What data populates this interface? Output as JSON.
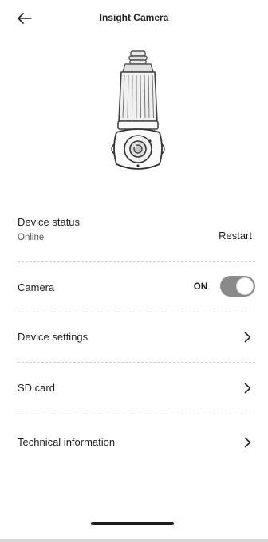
{
  "header": {
    "title": "Insight Camera",
    "back_icon": "arrow-left-icon"
  },
  "device": {
    "image": "bulb-camera-image"
  },
  "status": {
    "label": "Device status",
    "value": "Online",
    "restart_label": "Restart"
  },
  "camera": {
    "label": "Camera",
    "toggle_text": "ON",
    "toggle_on": true
  },
  "menu": {
    "items": [
      {
        "label": "Device settings",
        "icon": "chevron-right-icon"
      },
      {
        "label": "SD card",
        "icon": "chevron-right-icon"
      },
      {
        "label": "Technical information",
        "icon": "chevron-right-icon"
      }
    ]
  },
  "colors": {
    "toggle_track": "#8a8a8a",
    "divider": "#cfcfcf"
  }
}
